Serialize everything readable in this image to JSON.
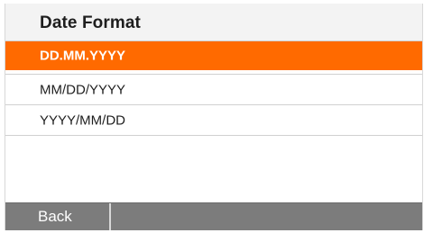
{
  "header": {
    "title": "Date Format"
  },
  "options": [
    {
      "label": "DD.MM.YYYY",
      "selected": true
    },
    {
      "label": "MM/DD/YYYY",
      "selected": false
    },
    {
      "label": "YYYY/MM/DD",
      "selected": false
    }
  ],
  "footer": {
    "back_label": "Back"
  },
  "colors": {
    "selected_background": "#ff6a00",
    "footer_background": "#7c7c7c",
    "header_background": "#f3f3f3"
  }
}
